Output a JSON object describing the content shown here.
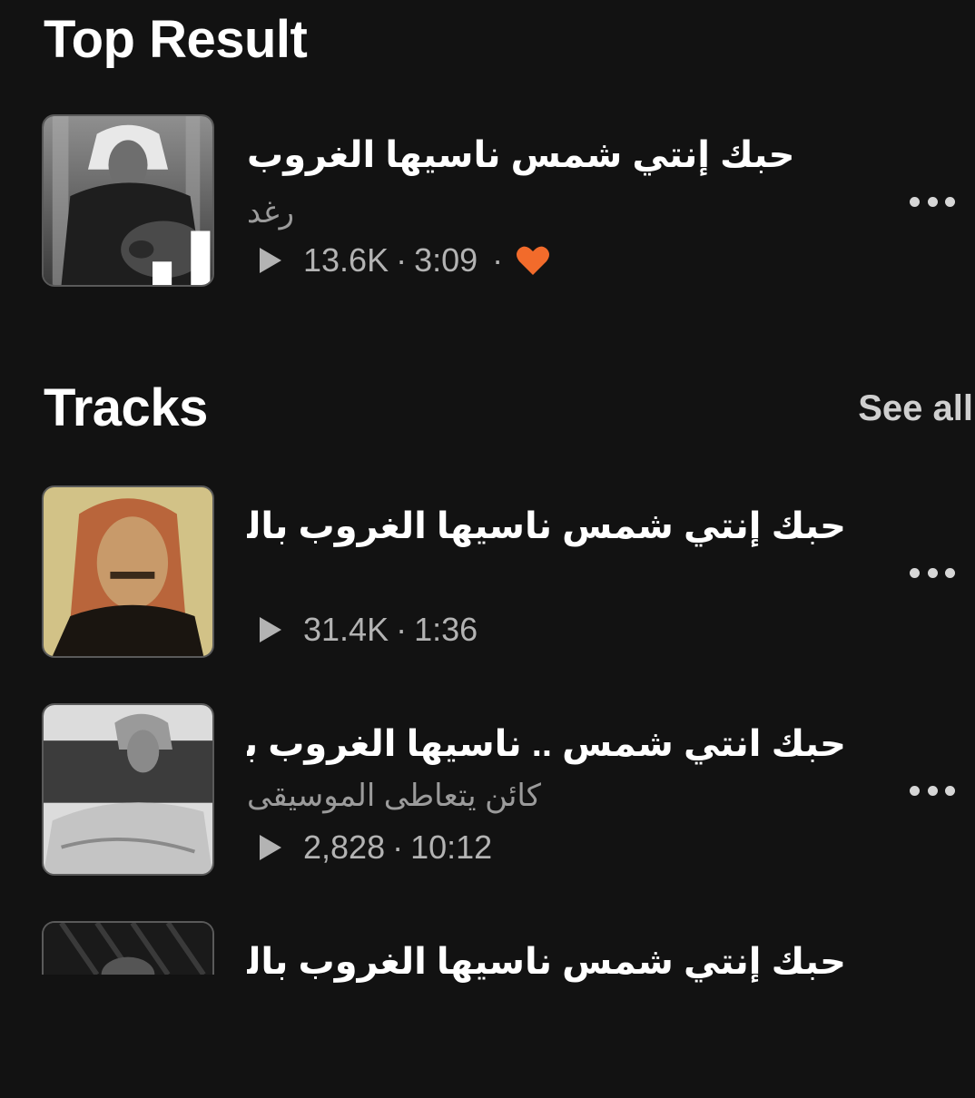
{
  "top_result": {
    "heading": "Top Result",
    "track": {
      "title": "حبك إنتي شمس ناسيها الغروب",
      "artist": "رغد",
      "plays": "13.6K",
      "duration": "3:09",
      "liked": true
    }
  },
  "tracks": {
    "heading": "Tracks",
    "see_all_label": "See all",
    "items": [
      {
        "title": "حبك إنتي شمس ناسيها الغروب بالحـ...",
        "artist": "",
        "plays": "31.4K",
        "duration": "1:36"
      },
      {
        "title": "حبك انتي شمس .. ناسيها الغروب بالـ...",
        "artist": "كائن يتعاطى الموسيقى",
        "plays": "2,828",
        "duration": "10:12"
      },
      {
        "title": "حبك إنتي شمس ناسيها الغروب بالحـ..."
      }
    ]
  },
  "meta_separator": "·",
  "colors": {
    "background": "#121212",
    "accent": "#f26b2b",
    "secondary_text": "#b3b3b3"
  },
  "icons": [
    "play-icon",
    "heart-icon",
    "more-options-icon",
    "now-playing-icon"
  ]
}
